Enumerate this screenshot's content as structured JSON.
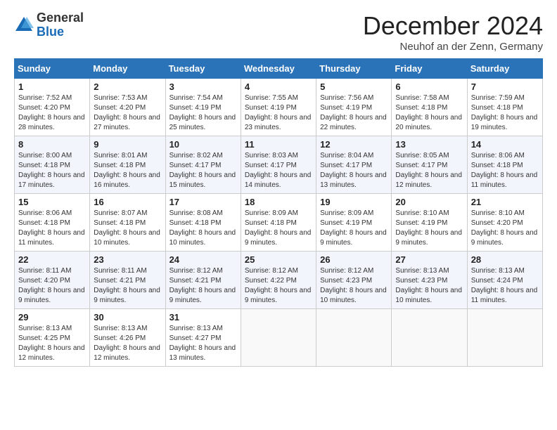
{
  "logo": {
    "general": "General",
    "blue": "Blue"
  },
  "header": {
    "month": "December 2024",
    "location": "Neuhof an der Zenn, Germany"
  },
  "days_of_week": [
    "Sunday",
    "Monday",
    "Tuesday",
    "Wednesday",
    "Thursday",
    "Friday",
    "Saturday"
  ],
  "weeks": [
    [
      {
        "day": "1",
        "sunrise": "7:52 AM",
        "sunset": "4:20 PM",
        "daylight": "8 hours and 28 minutes."
      },
      {
        "day": "2",
        "sunrise": "7:53 AM",
        "sunset": "4:20 PM",
        "daylight": "8 hours and 27 minutes."
      },
      {
        "day": "3",
        "sunrise": "7:54 AM",
        "sunset": "4:19 PM",
        "daylight": "8 hours and 25 minutes."
      },
      {
        "day": "4",
        "sunrise": "7:55 AM",
        "sunset": "4:19 PM",
        "daylight": "8 hours and 23 minutes."
      },
      {
        "day": "5",
        "sunrise": "7:56 AM",
        "sunset": "4:19 PM",
        "daylight": "8 hours and 22 minutes."
      },
      {
        "day": "6",
        "sunrise": "7:58 AM",
        "sunset": "4:18 PM",
        "daylight": "8 hours and 20 minutes."
      },
      {
        "day": "7",
        "sunrise": "7:59 AM",
        "sunset": "4:18 PM",
        "daylight": "8 hours and 19 minutes."
      }
    ],
    [
      {
        "day": "8",
        "sunrise": "8:00 AM",
        "sunset": "4:18 PM",
        "daylight": "8 hours and 17 minutes."
      },
      {
        "day": "9",
        "sunrise": "8:01 AM",
        "sunset": "4:18 PM",
        "daylight": "8 hours and 16 minutes."
      },
      {
        "day": "10",
        "sunrise": "8:02 AM",
        "sunset": "4:17 PM",
        "daylight": "8 hours and 15 minutes."
      },
      {
        "day": "11",
        "sunrise": "8:03 AM",
        "sunset": "4:17 PM",
        "daylight": "8 hours and 14 minutes."
      },
      {
        "day": "12",
        "sunrise": "8:04 AM",
        "sunset": "4:17 PM",
        "daylight": "8 hours and 13 minutes."
      },
      {
        "day": "13",
        "sunrise": "8:05 AM",
        "sunset": "4:17 PM",
        "daylight": "8 hours and 12 minutes."
      },
      {
        "day": "14",
        "sunrise": "8:06 AM",
        "sunset": "4:18 PM",
        "daylight": "8 hours and 11 minutes."
      }
    ],
    [
      {
        "day": "15",
        "sunrise": "8:06 AM",
        "sunset": "4:18 PM",
        "daylight": "8 hours and 11 minutes."
      },
      {
        "day": "16",
        "sunrise": "8:07 AM",
        "sunset": "4:18 PM",
        "daylight": "8 hours and 10 minutes."
      },
      {
        "day": "17",
        "sunrise": "8:08 AM",
        "sunset": "4:18 PM",
        "daylight": "8 hours and 10 minutes."
      },
      {
        "day": "18",
        "sunrise": "8:09 AM",
        "sunset": "4:18 PM",
        "daylight": "8 hours and 9 minutes."
      },
      {
        "day": "19",
        "sunrise": "8:09 AM",
        "sunset": "4:19 PM",
        "daylight": "8 hours and 9 minutes."
      },
      {
        "day": "20",
        "sunrise": "8:10 AM",
        "sunset": "4:19 PM",
        "daylight": "8 hours and 9 minutes."
      },
      {
        "day": "21",
        "sunrise": "8:10 AM",
        "sunset": "4:20 PM",
        "daylight": "8 hours and 9 minutes."
      }
    ],
    [
      {
        "day": "22",
        "sunrise": "8:11 AM",
        "sunset": "4:20 PM",
        "daylight": "8 hours and 9 minutes."
      },
      {
        "day": "23",
        "sunrise": "8:11 AM",
        "sunset": "4:21 PM",
        "daylight": "8 hours and 9 minutes."
      },
      {
        "day": "24",
        "sunrise": "8:12 AM",
        "sunset": "4:21 PM",
        "daylight": "8 hours and 9 minutes."
      },
      {
        "day": "25",
        "sunrise": "8:12 AM",
        "sunset": "4:22 PM",
        "daylight": "8 hours and 9 minutes."
      },
      {
        "day": "26",
        "sunrise": "8:12 AM",
        "sunset": "4:23 PM",
        "daylight": "8 hours and 10 minutes."
      },
      {
        "day": "27",
        "sunrise": "8:13 AM",
        "sunset": "4:23 PM",
        "daylight": "8 hours and 10 minutes."
      },
      {
        "day": "28",
        "sunrise": "8:13 AM",
        "sunset": "4:24 PM",
        "daylight": "8 hours and 11 minutes."
      }
    ],
    [
      {
        "day": "29",
        "sunrise": "8:13 AM",
        "sunset": "4:25 PM",
        "daylight": "8 hours and 12 minutes."
      },
      {
        "day": "30",
        "sunrise": "8:13 AM",
        "sunset": "4:26 PM",
        "daylight": "8 hours and 12 minutes."
      },
      {
        "day": "31",
        "sunrise": "8:13 AM",
        "sunset": "4:27 PM",
        "daylight": "8 hours and 13 minutes."
      },
      null,
      null,
      null,
      null
    ]
  ],
  "labels": {
    "sunrise": "Sunrise:",
    "sunset": "Sunset:",
    "daylight": "Daylight:"
  }
}
